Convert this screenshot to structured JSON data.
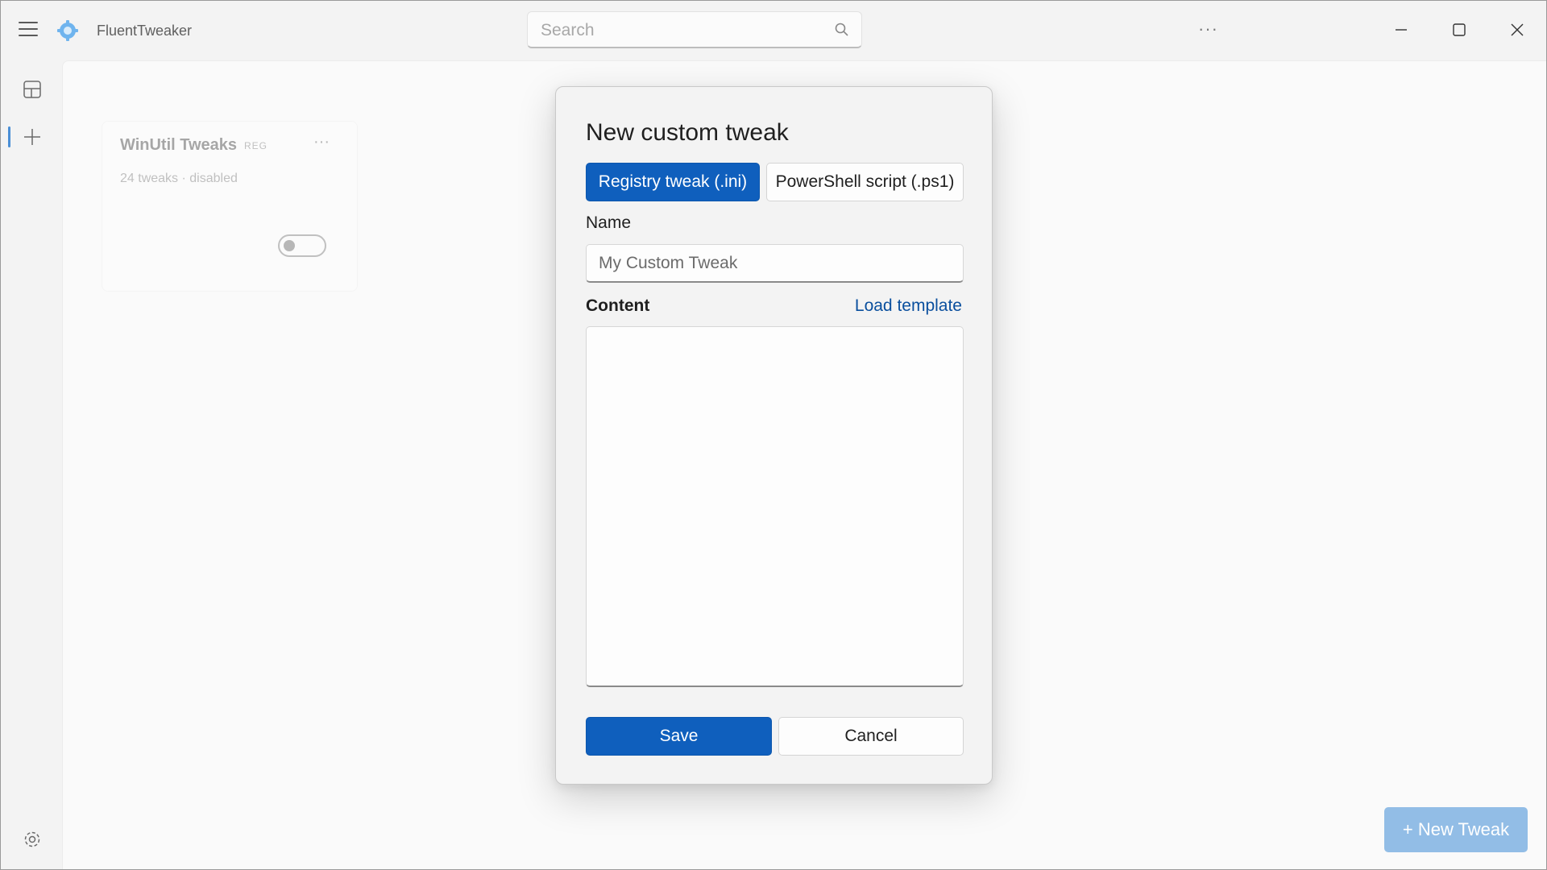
{
  "app": {
    "title": "FluentTweaker"
  },
  "search": {
    "placeholder": "Search"
  },
  "titlebar": {
    "more": "···"
  },
  "card": {
    "title": "WinUtil Tweaks",
    "badge": "REG",
    "more": "···",
    "subtitle": "24 tweaks · disabled",
    "enabled": false
  },
  "new_tweak_button": "+ New Tweak",
  "dialog": {
    "title": "New custom tweak",
    "segments": [
      "Registry tweak (.ini)",
      "PowerShell script (.ps1)"
    ],
    "selected_segment": "Registry tweak (.ini)",
    "name_label": "Name",
    "name_placeholder": "My Custom Tweak",
    "name_value": "",
    "content_label": "Content",
    "load_template": "Load template",
    "content_value": "",
    "save": "Save",
    "cancel": "Cancel"
  },
  "colors": {
    "accent": "#0f5fbd",
    "link": "#0a4f9e",
    "disabled_accent": "#92bde6"
  }
}
